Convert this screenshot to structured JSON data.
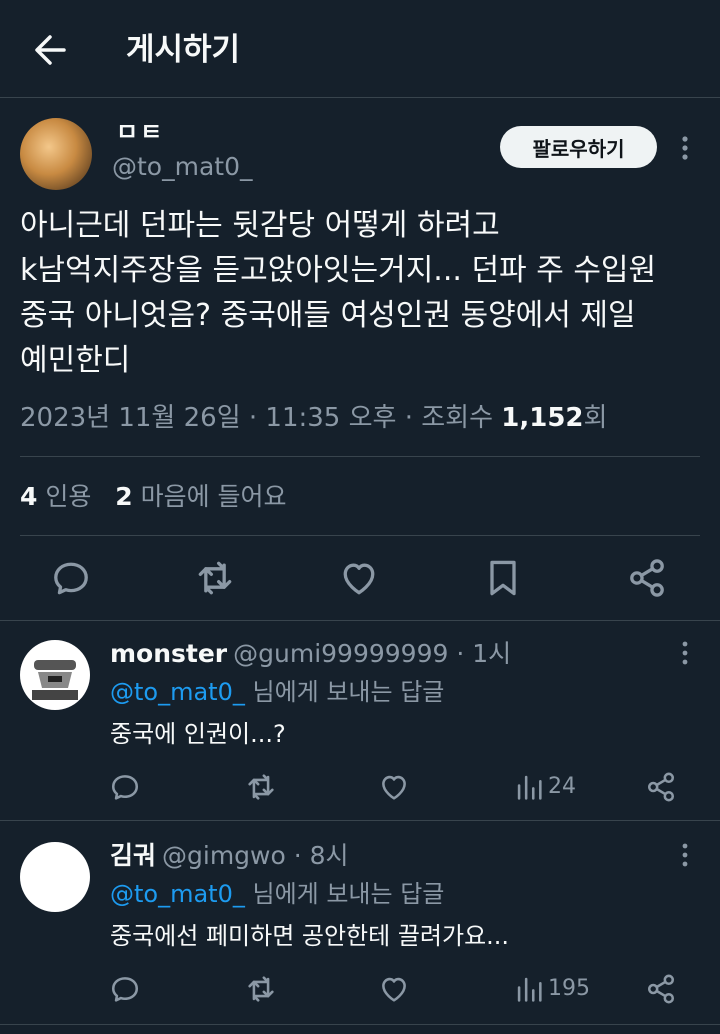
{
  "header": {
    "title": "게시하기"
  },
  "tweet": {
    "author_name": "ㅁㅌ",
    "handle": "@to_mat0_",
    "follow_label": "팔로우하기",
    "text_lines": [
      "아니근데 던파는 뒷감당 어떻게 하려고",
      "k남억지주장을 듣고앉아잇는거지... 던파 주 수입원",
      "중국 아니엇음? 중국애들 여성인권 동양에서 제일",
      "예민한디"
    ],
    "meta_prefix": "2023년 11월 26일 · 11:35 오후 · 조회수 ",
    "views": "1,152",
    "meta_suffix": "회",
    "quotes_count": "4",
    "quotes_label": "인용",
    "likes_count": "2",
    "likes_label": "마음에 들어요"
  },
  "replies": [
    {
      "name": "monster",
      "handle": "@gumi99999999",
      "time": "· 1시",
      "reply_to_mention": "@to_mat0_",
      "reply_to_suffix": " 님에게 보내는 답글",
      "text": "중국에 인권이...?",
      "views": "24"
    },
    {
      "name": "김궈",
      "handle": "@gimgwo",
      "time": "· 8시",
      "reply_to_mention": "@to_mat0_",
      "reply_to_suffix": " 님에게 보내는 답글",
      "text": "중국에선 페미하면 공안한테 끌려가요...",
      "views": "195"
    }
  ],
  "colors": {
    "background": "#15202b",
    "text": "#f7f9f9",
    "secondary": "#8b98a5",
    "accent": "#1d9bf0",
    "divider": "#38444d"
  },
  "icons": [
    "back-arrow-icon",
    "more-icon",
    "reply-icon",
    "retweet-icon",
    "like-icon",
    "bookmark-icon",
    "share-icon",
    "views-icon"
  ]
}
